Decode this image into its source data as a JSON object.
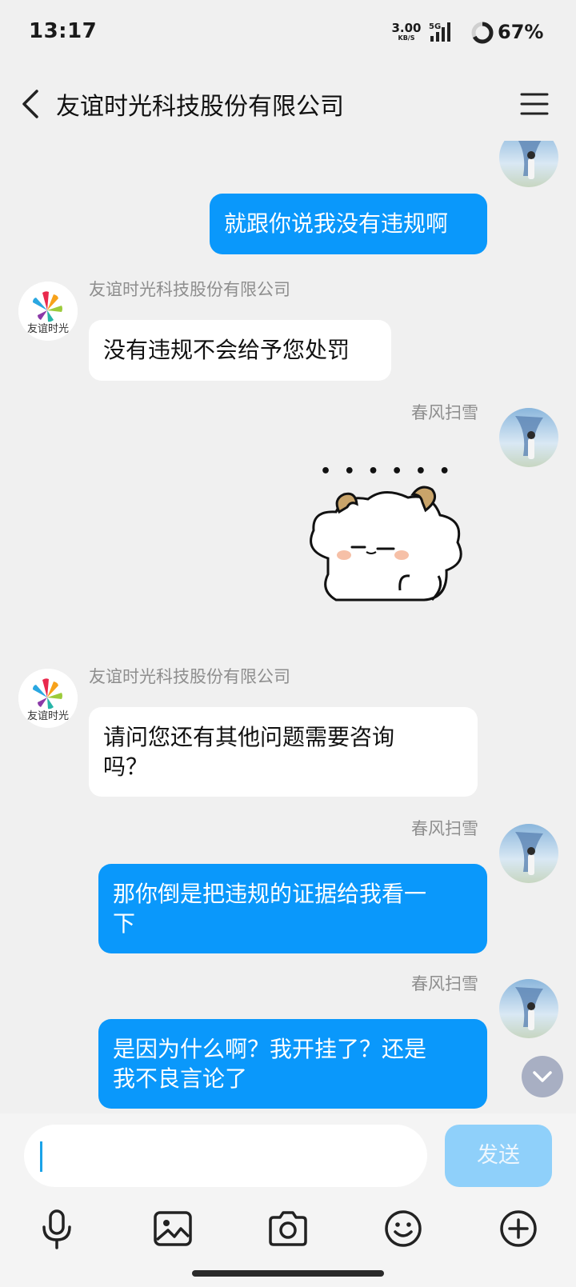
{
  "status_bar": {
    "time": "13:17",
    "net_speed_value": "3.00",
    "net_speed_unit": "KB/S",
    "network": "5G",
    "battery_percent": "67%",
    "battery_level": 0.67
  },
  "header": {
    "title": "友谊时光科技股份有限公司"
  },
  "company": {
    "name": "友谊时光科技股份有限公司",
    "logo_text": "友谊时光"
  },
  "messages": [
    {
      "side": "sent",
      "text": "就跟你说我没有违规啊"
    },
    {
      "side": "received",
      "sender": "友谊时光科技股份有限公司",
      "text": "没有违规不会给予您处罚"
    },
    {
      "side": "sent",
      "sender": "春风扫雪",
      "type": "sticker",
      "sticker_text": "• • • • • •",
      "sticker_icon": "sheep-sticker"
    },
    {
      "side": "received",
      "sender": "友谊时光科技股份有限公司",
      "line1": "请问您还有其他问题需要咨询",
      "line2": "吗？"
    },
    {
      "side": "sent",
      "sender": "春风扫雪",
      "line1": "那你倒是把违规的证据给我看一",
      "line2": "下"
    },
    {
      "side": "sent",
      "sender": "春风扫雪",
      "line1": "是因为什么啊？我开挂了？还是",
      "line2": "我不良言论了"
    }
  ],
  "input": {
    "value": "",
    "send_label": "发送"
  },
  "toolbar": {
    "icons": [
      "microphone-icon",
      "image-icon",
      "camera-icon",
      "emoji-icon",
      "plus-icon"
    ]
  },
  "colors": {
    "sent_bubble": "#0a98fb",
    "received_bubble": "#ffffff",
    "background": "#f0f0f0",
    "send_button": "#8fd0fa"
  }
}
